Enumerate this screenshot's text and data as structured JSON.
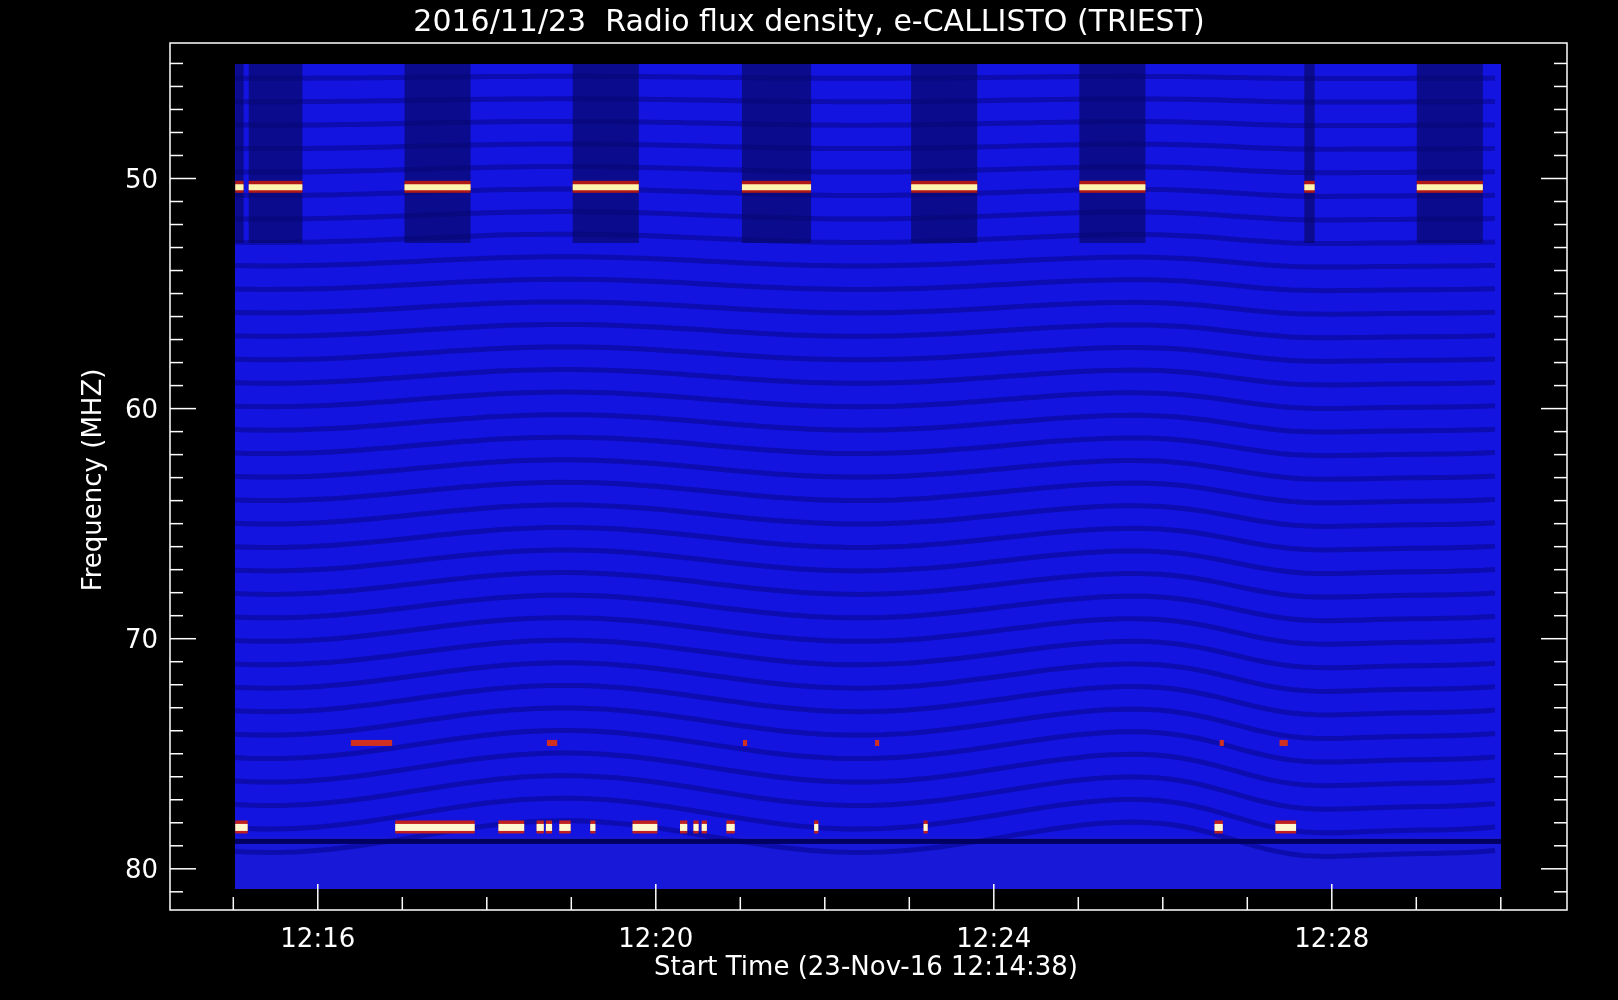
{
  "title": "2016/11/23  Radio flux density, e-CALLISTO (TRIEST)",
  "x_axis": {
    "label": "Start Time (23-Nov-16 12:14:38)",
    "ticks": [
      "12:16",
      "12:20",
      "12:24",
      "12:28"
    ]
  },
  "y_axis": {
    "label": "Frequency (MHZ)",
    "ticks": [
      "50",
      "60",
      "70",
      "80"
    ]
  }
}
